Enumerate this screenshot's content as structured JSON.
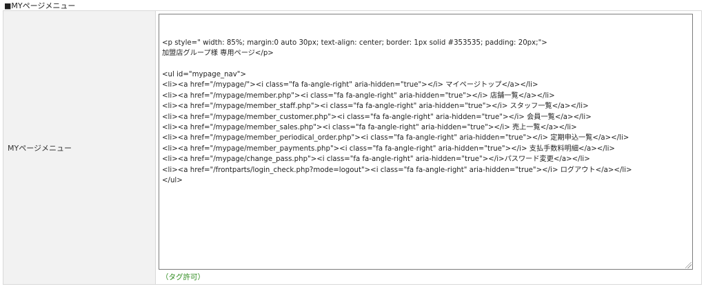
{
  "section": {
    "title": "■MYページメニュー"
  },
  "field": {
    "label": "MYページメニュー",
    "hint": "（タグ許可）",
    "code_lines": [
      "<p style=\" width: 85%; margin:0 auto 30px; text-align: center; border: 1px solid #353535; padding: 20px;\">",
      "加盟店グループ様 専用ページ</p>",
      "",
      "<ul id=\"mypage_nav\">",
      "<li><a href=\"/mypage/\"><i class=\"fa fa-angle-right\" aria-hidden=\"true\"></i> マイページトップ</a></li>",
      "<li><a href=\"/mypage/member.php\"><i class=\"fa fa-angle-right\" aria-hidden=\"true\"></i> 店舗一覧</a></li>",
      "<li><a href=\"/mypage/member_staff.php\"><i class=\"fa fa-angle-right\" aria-hidden=\"true\"></i> スタッフ一覧</a></li>",
      "<li><a href=\"/mypage/member_customer.php\"><i class=\"fa fa-angle-right\" aria-hidden=\"true\"></i> 会員一覧</a></li>",
      "<li><a href=\"/mypage/member_sales.php\"><i class=\"fa fa-angle-right\" aria-hidden=\"true\"></i> 売上一覧</a></li>",
      "<li><a href=\"/mypage/member_periodical_order.php\"><i class=\"fa fa-angle-right\" aria-hidden=\"true\"></i> 定期申込一覧</a></li>",
      "<li><a href=\"/mypage/member_payments.php\"><i class=\"fa fa-angle-right\" aria-hidden=\"true\"></i> 支払手数料明細</a></li>",
      "<li><a href=\"/mypage/change_pass.php\"><i class=\"fa fa-angle-right\" aria-hidden=\"true\"></i>パスワード変更</a></li>",
      "<li><a href=\"/frontparts/login_check.php?mode=logout\"><i class=\"fa fa-angle-right\" aria-hidden=\"true\"></i> ログアウト</a></li>",
      "</ul>"
    ]
  }
}
